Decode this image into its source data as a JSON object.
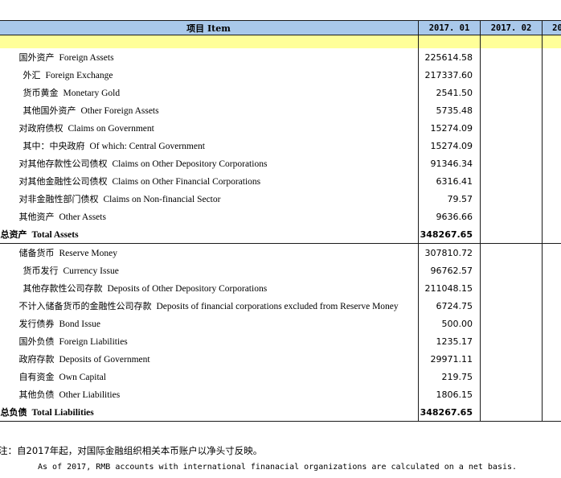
{
  "header": {
    "item_label": "项目 Item",
    "months": [
      "2017. 01",
      "2017. 02",
      "20"
    ]
  },
  "rows": [
    {
      "cn": "国外资产",
      "en": "Foreign Assets",
      "v": "225614.58"
    },
    {
      "cn": "外汇",
      "en": "Foreign Exchange",
      "v": "217337.60"
    },
    {
      "cn": "货币黄金",
      "en": "Monetary Gold",
      "v": "2541.50"
    },
    {
      "cn": "其他国外资产",
      "en": "Other Foreign Assets",
      "v": "5735.48"
    },
    {
      "cn": "对政府债权",
      "en": "Claims on Government",
      "v": "15274.09"
    },
    {
      "cn": "其中：中央政府",
      "en": "Of which: Central Government",
      "v": "15274.09"
    },
    {
      "cn": "对其他存款性公司债权",
      "en": "Claims on Other Depository Corporations",
      "v": "91346.34"
    },
    {
      "cn": "对其他金融性公司债权",
      "en": "Claims on Other Financial Corporations",
      "v": "6316.41"
    },
    {
      "cn": "对非金融性部门债权",
      "en": "Claims on Non-financial Sector",
      "v": "79.57"
    },
    {
      "cn": "其他资产",
      "en": "Other Assets",
      "v": "9636.66"
    },
    {
      "cn": "总资产",
      "en": "Total Assets",
      "v": "348267.65"
    },
    {
      "cn": "储备货币",
      "en": "Reserve Money",
      "v": "307810.72"
    },
    {
      "cn": "货币发行",
      "en": "Currency Issue",
      "v": "96762.57"
    },
    {
      "cn": "其他存款性公司存款",
      "en": "Deposits of  Other Depository Corporations",
      "v": "211048.15"
    },
    {
      "cn": "不计入储备货币的金融性公司存款",
      "en": "Deposits of financial corporations excluded from Reserve Money",
      "v": "6724.75"
    },
    {
      "cn": "发行债券",
      "en": "Bond Issue",
      "v": "500.00"
    },
    {
      "cn": "国外负债",
      "en": "Foreign Liabilities",
      "v": "1235.17"
    },
    {
      "cn": "政府存款",
      "en": "Deposits of Government",
      "v": "29971.11"
    },
    {
      "cn": "自有资金",
      "en": "Own Capital",
      "v": "219.75"
    },
    {
      "cn": "其他负债",
      "en": "Other Liabilities",
      "v": "1806.15"
    },
    {
      "cn": "总负债",
      "en": "Total  Liabilities",
      "v": "348267.65"
    }
  ],
  "notes": {
    "cn": "注：自2017年起，对国际金融组织相关本币账户以净头寸反映。",
    "en": "As of 2017, RMB accounts with international finanacial organizations are calculated on a net basis."
  }
}
